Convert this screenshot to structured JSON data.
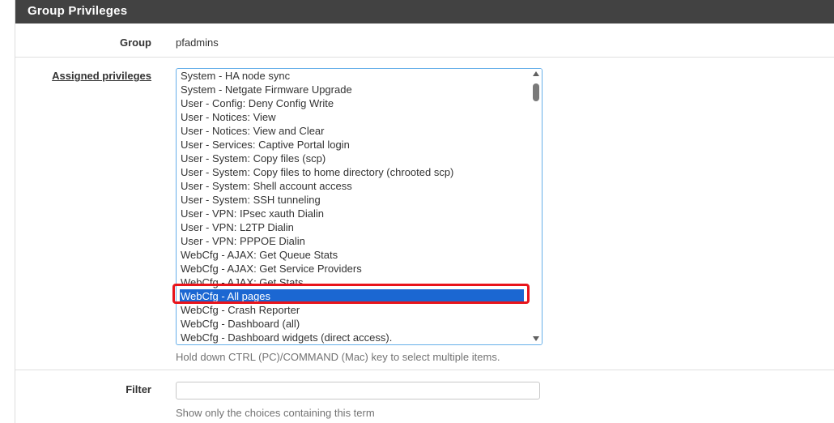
{
  "panel": {
    "title": "Group Privileges"
  },
  "group": {
    "label": "Group",
    "value": "pfadmins"
  },
  "privileges": {
    "label": "Assigned privileges",
    "items": [
      "System - HA node sync",
      "System - Netgate Firmware Upgrade",
      "User - Config: Deny Config Write",
      "User - Notices: View",
      "User - Notices: View and Clear",
      "User - Services: Captive Portal login",
      "User - System: Copy files (scp)",
      "User - System: Copy files to home directory (chrooted scp)",
      "User - System: Shell account access",
      "User - System: SSH tunneling",
      "User - VPN: IPsec xauth Dialin",
      "User - VPN: L2TP Dialin",
      "User - VPN: PPPOE Dialin",
      "WebCfg - AJAX: Get Queue Stats",
      "WebCfg - AJAX: Get Service Providers",
      "WebCfg - AJAX: Get Stats",
      "WebCfg - All pages",
      "WebCfg - Crash Reporter",
      "WebCfg - Dashboard (all)",
      "WebCfg - Dashboard widgets (direct access)."
    ],
    "selected_item": "WebCfg - All pages",
    "help": "Hold down CTRL (PC)/COMMAND (Mac) key to select multiple items."
  },
  "filter": {
    "label": "Filter",
    "value": "",
    "help": "Show only the choices containing this term"
  },
  "colors": {
    "header_bg": "#424242",
    "selection": "#1b67d2",
    "highlight_box": "#e8141b",
    "focus_border": "#66afe9"
  }
}
